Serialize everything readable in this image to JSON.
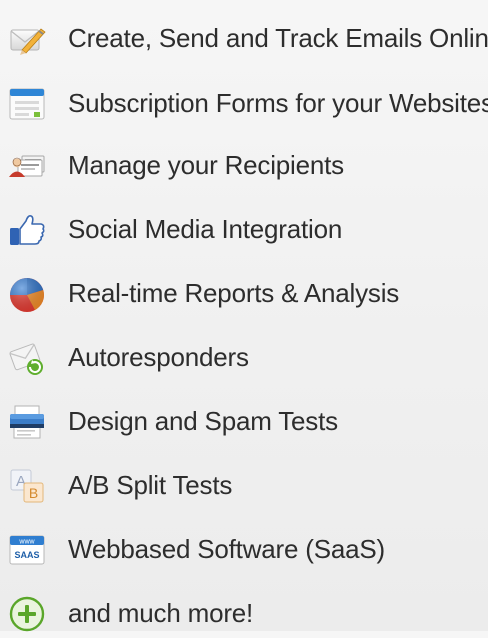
{
  "features": [
    {
      "label": "Create, Send and Track Emails Online",
      "icon": "envelope-pencil-icon"
    },
    {
      "label": "Subscription Forms for your Websites",
      "icon": "web-form-icon"
    },
    {
      "label": "Manage your Recipients",
      "icon": "recipients-icon"
    },
    {
      "label": "Social Media Integration",
      "icon": "thumbs-up-icon"
    },
    {
      "label": "Real-time Reports & Analysis",
      "icon": "pie-chart-icon"
    },
    {
      "label": "Autoresponders",
      "icon": "autoresponder-envelope-icon"
    },
    {
      "label": "Design and Spam Tests",
      "icon": "printer-icon"
    },
    {
      "label": "A/B Split Tests",
      "icon": "ab-test-icon"
    },
    {
      "label": "Webbased Software (SaaS)",
      "icon": "saas-icon"
    },
    {
      "label": "and much more!",
      "icon": "plus-circle-icon"
    }
  ],
  "icon_text": {
    "saas_top": "www",
    "saas_bottom": "SAAS",
    "ab_a": "A",
    "ab_b": "B"
  }
}
